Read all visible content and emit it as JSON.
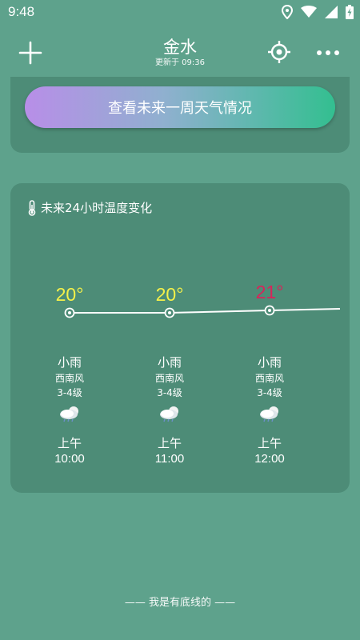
{
  "status_bar": {
    "time": "9:48"
  },
  "header": {
    "city": "金水",
    "update_text": "更新于 09:36"
  },
  "week_button": {
    "label": "查看未来一周天气情况"
  },
  "hourly": {
    "title": "未来24小时温度变化",
    "items": [
      {
        "temp": "20°",
        "temp_color": "#f4f04a",
        "condition": "小雨",
        "wind": "西南风",
        "level": "3-4级",
        "icon": "light-rain-icon",
        "ampm": "上午",
        "time": "10:00"
      },
      {
        "temp": "20°",
        "temp_color": "#f4f04a",
        "condition": "小雨",
        "wind": "西南风",
        "level": "3-4级",
        "icon": "light-rain-icon",
        "ampm": "上午",
        "time": "11:00"
      },
      {
        "temp": "21°",
        "temp_color": "#d8245a",
        "condition": "小雨",
        "wind": "西南风",
        "level": "3-4级",
        "icon": "light-rain-icon",
        "ampm": "上午",
        "time": "12:00"
      }
    ]
  },
  "footer": {
    "text": "—— 我是有底线的 ——"
  }
}
